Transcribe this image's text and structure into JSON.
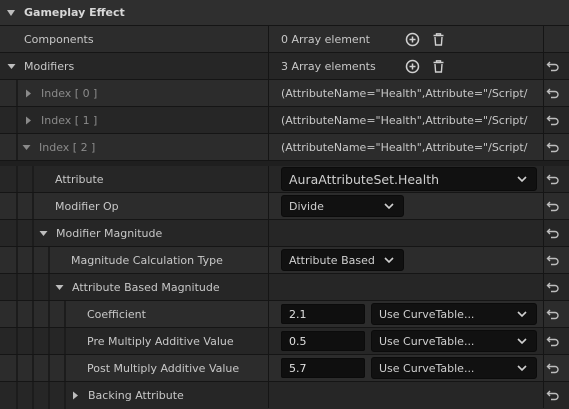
{
  "section": {
    "title": "Gameplay Effect"
  },
  "components": {
    "label": "Components",
    "value": "0 Array element"
  },
  "modifiers": {
    "label": "Modifiers",
    "value": "3 Array elements",
    "elements": [
      {
        "label": "Index [ 0 ]",
        "value": "(AttributeName=\"Health\",Attribute=\"/Script/"
      },
      {
        "label": "Index [ 1 ]",
        "value": "(AttributeName=\"Health\",Attribute=\"/Script/"
      },
      {
        "label": "Index [ 2 ]",
        "value": "(AttributeName=\"Health\",Attribute=\"/Script/"
      }
    ]
  },
  "attribute": {
    "label": "Attribute",
    "value": "AuraAttributeSet.Health"
  },
  "modifier_op": {
    "label": "Modifier Op",
    "value": "Divide"
  },
  "modifier_magnitude": {
    "label": "Modifier Magnitude"
  },
  "calc_type": {
    "label": "Magnitude Calculation Type",
    "value": "Attribute Based"
  },
  "attr_based": {
    "label": "Attribute Based Magnitude"
  },
  "coefficient": {
    "label": "Coefficient",
    "value": "2.1",
    "curve": "Use CurveTable..."
  },
  "pre_mult": {
    "label": "Pre Multiply Additive Value",
    "value": "0.5",
    "curve": "Use CurveTable..."
  },
  "post_mult": {
    "label": "Post Multiply Additive Value",
    "value": "5.7",
    "curve": "Use CurveTable..."
  },
  "backing": {
    "label": "Backing Attribute"
  },
  "icons": {
    "add": "add-circle-icon",
    "delete": "trash-icon",
    "reset": "reset-arrow-icon",
    "expand": "triangle-icon",
    "dropdown": "chevron-down-icon"
  }
}
